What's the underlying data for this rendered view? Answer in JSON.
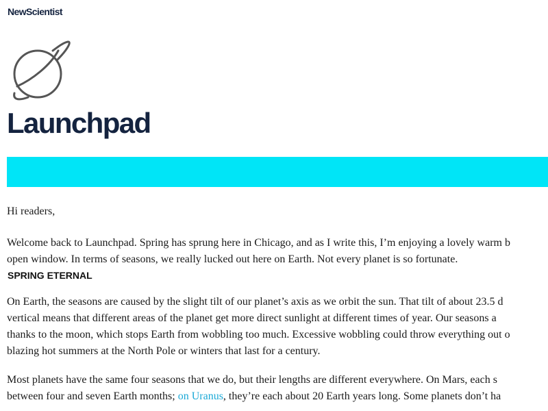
{
  "header": {
    "brand": "NewScientist",
    "icon": "planet-icon",
    "title": "Launchpad"
  },
  "colors": {
    "accent_band": "#00e5f7",
    "title": "#14233f",
    "link": "#1aa8d6"
  },
  "body": {
    "greeting": "Hi readers,",
    "intro_lines": [
      "Welcome back to Launchpad. Spring has sprung here in Chicago, and as I write this, I’m enjoying a lovely warm b",
      "open window. In terms of seasons, we really lucked out here on Earth. Not every planet is so fortunate."
    ],
    "section_heading": "SPRING ETERNAL",
    "paragraph1_lines": [
      "On Earth, the seasons are caused by the slight tilt of our planet’s axis as we orbit the sun. That tilt of about 23.5 d",
      "vertical means that different areas of the planet get more direct sunlight at different times of year. Our seasons a",
      "thanks to the moon, which stops Earth from wobbling too much. Excessive wobbling could throw everything out o",
      "blazing hot summers at the North Pole or winters that last for a century."
    ],
    "paragraph2_line1": "Most planets have the same four seasons that we do, but their lengths are different everywhere. On Mars, each s",
    "paragraph2_line2_before": "between four and seven Earth months; ",
    "paragraph2_link": "on Uranus",
    "paragraph2_line2_after": ", they’re each about 20 Earth years long. Some planets don’t ha"
  }
}
